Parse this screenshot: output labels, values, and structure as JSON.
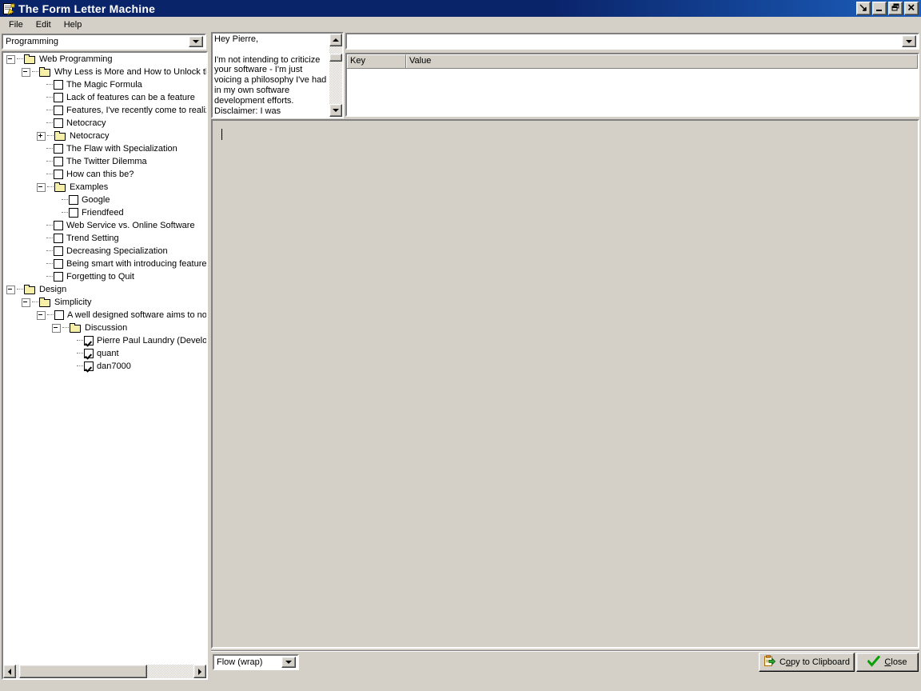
{
  "window": {
    "title": "The Form Letter Machine",
    "icon": "form-letter-icon",
    "buttons": [
      {
        "name": "rollup-button",
        "glyph": "↘"
      },
      {
        "name": "minimize-button",
        "glyph": "_"
      },
      {
        "name": "maximize-button",
        "glyph": "❐"
      },
      {
        "name": "close-button",
        "glyph": "✕"
      }
    ]
  },
  "menubar": {
    "items": [
      {
        "label": "File"
      },
      {
        "label": "Edit"
      },
      {
        "label": "Help"
      }
    ]
  },
  "category_combo": {
    "value": "Programming",
    "placeholder": ""
  },
  "field_combo": {
    "value": "",
    "placeholder": ""
  },
  "preview": {
    "text": "Hey Pierre,\n\nI'm not intending to criticize your software - I'm just voicing a philosophy I've had in my own software development efforts. Disclaimer: I was engineering manager for",
    "scroll_thumb_top_pct": 13,
    "scroll_thumb_height_pct": 14
  },
  "keyvalue": {
    "columns": [
      "Key",
      "Value"
    ],
    "rows": []
  },
  "editor": {
    "value": "",
    "enabled": false
  },
  "format_combo": {
    "value": "Flow (wrap)"
  },
  "actions": {
    "copy_label_pre": "C",
    "copy_label_accel": "o",
    "copy_label_post": "py to Clipboard",
    "copy_label": "Copy to Clipboard",
    "close_label_accel": "C",
    "close_label_post": "lose",
    "close_label": "Close"
  },
  "tree": {
    "hscroll": {
      "thumb_left_pct": 2,
      "thumb_width_pct": 72
    },
    "nodes": [
      {
        "depth": 0,
        "type": "folder",
        "expander": "minus",
        "label": "Web Programming"
      },
      {
        "depth": 1,
        "type": "folder",
        "expander": "minus",
        "label": "Why Less is More and How to Unlock the"
      },
      {
        "depth": 2,
        "type": "check",
        "expander": "none",
        "checked": false,
        "label": "The Magic Formula"
      },
      {
        "depth": 2,
        "type": "check",
        "expander": "none",
        "checked": false,
        "label": "Lack of features can be a feature"
      },
      {
        "depth": 2,
        "type": "check",
        "expander": "none",
        "checked": false,
        "label": "Features, I've recently come to realize"
      },
      {
        "depth": 2,
        "type": "check",
        "expander": "none",
        "checked": false,
        "label": "Netocracy"
      },
      {
        "depth": 2,
        "type": "folder",
        "expander": "plus",
        "label": "Netocracy"
      },
      {
        "depth": 2,
        "type": "check",
        "expander": "none",
        "checked": false,
        "label": "The Flaw with Specialization"
      },
      {
        "depth": 2,
        "type": "check",
        "expander": "none",
        "checked": false,
        "label": "The Twitter Dilemma"
      },
      {
        "depth": 2,
        "type": "check",
        "expander": "none",
        "checked": false,
        "label": "How can this be?"
      },
      {
        "depth": 2,
        "type": "folder",
        "expander": "minus",
        "label": "Examples"
      },
      {
        "depth": 3,
        "type": "check",
        "expander": "none",
        "checked": false,
        "label": "Google"
      },
      {
        "depth": 3,
        "type": "check",
        "expander": "none",
        "checked": false,
        "label": "Friendfeed"
      },
      {
        "depth": 2,
        "type": "check",
        "expander": "none",
        "checked": false,
        "label": "Web Service vs. Online Software"
      },
      {
        "depth": 2,
        "type": "check",
        "expander": "none",
        "checked": false,
        "label": "Trend Setting"
      },
      {
        "depth": 2,
        "type": "check",
        "expander": "none",
        "checked": false,
        "label": "Decreasing Specialization"
      },
      {
        "depth": 2,
        "type": "check",
        "expander": "none",
        "checked": false,
        "label": "Being smart with introducing features"
      },
      {
        "depth": 2,
        "type": "check",
        "expander": "none",
        "checked": false,
        "label": "Forgetting to Quit"
      },
      {
        "depth": 0,
        "type": "folder",
        "expander": "minus",
        "label": "Design"
      },
      {
        "depth": 1,
        "type": "folder",
        "expander": "minus",
        "label": "Simplicity"
      },
      {
        "depth": 2,
        "type": "check",
        "expander": "minus",
        "checked": false,
        "label": "A well designed software aims to not r"
      },
      {
        "depth": 3,
        "type": "folder",
        "expander": "minus",
        "label": "Discussion"
      },
      {
        "depth": 4,
        "type": "check",
        "expander": "none",
        "checked": true,
        "label": "Pierre Paul Laundry (Develop"
      },
      {
        "depth": 4,
        "type": "check",
        "expander": "none",
        "checked": true,
        "label": "quant"
      },
      {
        "depth": 4,
        "type": "check",
        "expander": "none",
        "checked": true,
        "label": "dan7000"
      }
    ]
  },
  "colors": {
    "face": "#d4d0c8",
    "title_start": "#0a246a",
    "title_end": "#1c5fbc",
    "folder": "#f5efa8",
    "accent_green": "#00a000",
    "accent_orange": "#e8951a"
  }
}
